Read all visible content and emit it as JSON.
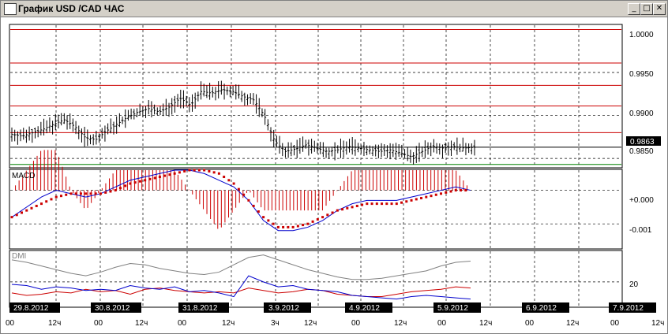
{
  "window": {
    "title": "График USD /CAD  ЧАС",
    "minimize": "_",
    "maximize": "□",
    "close": "✕"
  },
  "price_axis": {
    "labels": [
      "1.0000",
      "0.9950",
      "0.9900",
      "0.9850"
    ],
    "current_price": "0.9863"
  },
  "macd": {
    "label": "MACD",
    "axis_labels": [
      "+0.000",
      "-0.001"
    ]
  },
  "dmi": {
    "label": "DMI",
    "axis_labels": [
      "20"
    ]
  },
  "dates": [
    "29.8.2012",
    "30.8.2012",
    "31.8.2012",
    "3.9.2012",
    "4.9.2012",
    "5.9.2012",
    "6.9.2012",
    "7.9.2012"
  ],
  "hour_ticks": [
    "00",
    "12ч",
    "00",
    "12ч",
    "00",
    "12ч",
    "3ч",
    "12ч",
    "00",
    "12ч",
    "00",
    "12ч",
    "00",
    "12ч",
    "00",
    "12ч"
  ],
  "colors": {
    "price_bars": "#000000",
    "resistance_lines": "#cc0000",
    "support_line": "#008000",
    "macd_line": "#0000cc",
    "macd_signal": "#cc0000",
    "dmi_plus": "#cc0000",
    "dmi_minus": "#0000cc",
    "adx": "#808080"
  },
  "chart_data": {
    "type": "line",
    "symbol": "USD/CAD",
    "timeframe": "ЧАС",
    "price": {
      "ylim": [
        0.984,
        1.0005
      ],
      "horizontal_levels": [
        1.0,
        0.9961,
        0.9935,
        0.9911,
        0.988
      ],
      "support_level": 0.9843,
      "current_price": 0.9863,
      "close_series": [
        0.9878,
        0.9876,
        0.988,
        0.9884,
        0.989,
        0.9895,
        0.9887,
        0.9874,
        0.9872,
        0.9882,
        0.989,
        0.9898,
        0.9904,
        0.9908,
        0.9904,
        0.991,
        0.992,
        0.9912,
        0.9928,
        0.9926,
        0.993,
        0.9928,
        0.9922,
        0.9918,
        0.99,
        0.987,
        0.9858,
        0.9861,
        0.9866,
        0.9862,
        0.9858,
        0.986,
        0.9864,
        0.9862,
        0.986,
        0.9858,
        0.986,
        0.9856,
        0.9852,
        0.9858,
        0.9864,
        0.9862,
        0.9864,
        0.9862,
        0.9863
      ]
    },
    "macd": {
      "ylim": [
        -0.0017,
        0.0006
      ],
      "macd_line": [
        -0.0008,
        -0.0005,
        -0.0002,
        0.0,
        -0.0001,
        -0.0002,
        -0.0001,
        0.0001,
        0.0003,
        0.0004,
        0.0005,
        0.0006,
        0.0006,
        0.0005,
        0.0003,
        0.0001,
        -0.0003,
        -0.0009,
        -0.0012,
        -0.0012,
        -0.0011,
        -0.0009,
        -0.0006,
        -0.0004,
        -0.0003,
        -0.0003,
        -0.0003,
        -0.0002,
        -0.0001,
        0.0,
        0.0001,
        0.0
      ],
      "signal_line": [
        -0.0008,
        -0.0006,
        -0.0004,
        -0.0002,
        -0.0001,
        -0.0001,
        -0.0001,
        0.0,
        0.0002,
        0.0003,
        0.0004,
        0.0005,
        0.0006,
        0.0006,
        0.0005,
        0.0002,
        -0.0003,
        -0.0008,
        -0.0011,
        -0.0011,
        -0.001,
        -0.0008,
        -0.0006,
        -0.0005,
        -0.0004,
        -0.0004,
        -0.0004,
        -0.0003,
        -0.0002,
        -0.0001,
        0.0,
        0.0
      ]
    },
    "dmi": {
      "ylim": [
        0,
        45
      ],
      "level": 20,
      "adx": [
        38,
        36,
        33,
        30,
        27,
        25,
        28,
        32,
        35,
        34,
        31,
        29,
        27,
        26,
        28,
        34,
        40,
        42,
        38,
        34,
        30,
        27,
        24,
        22,
        22,
        23,
        25,
        27,
        29,
        33,
        36,
        37
      ],
      "plus_di": [
        11,
        9,
        10,
        12,
        11,
        14,
        12,
        13,
        10,
        14,
        15,
        13,
        12,
        11,
        12,
        11,
        15,
        13,
        11,
        12,
        14,
        13,
        10,
        9,
        8,
        8,
        10,
        12,
        13,
        14,
        16,
        15
      ],
      "minus_di": [
        18,
        17,
        14,
        16,
        15,
        13,
        14,
        13,
        17,
        15,
        14,
        16,
        12,
        13,
        11,
        8,
        25,
        20,
        16,
        17,
        14,
        13,
        12,
        9,
        8,
        7,
        6,
        8,
        9,
        8,
        7,
        6
      ]
    },
    "x_labels": [
      "29.8.2012",
      "30.8.2012",
      "31.8.2012",
      "3.9.2012",
      "4.9.2012",
      "5.9.2012",
      "6.9.2012",
      "7.9.2012"
    ]
  }
}
